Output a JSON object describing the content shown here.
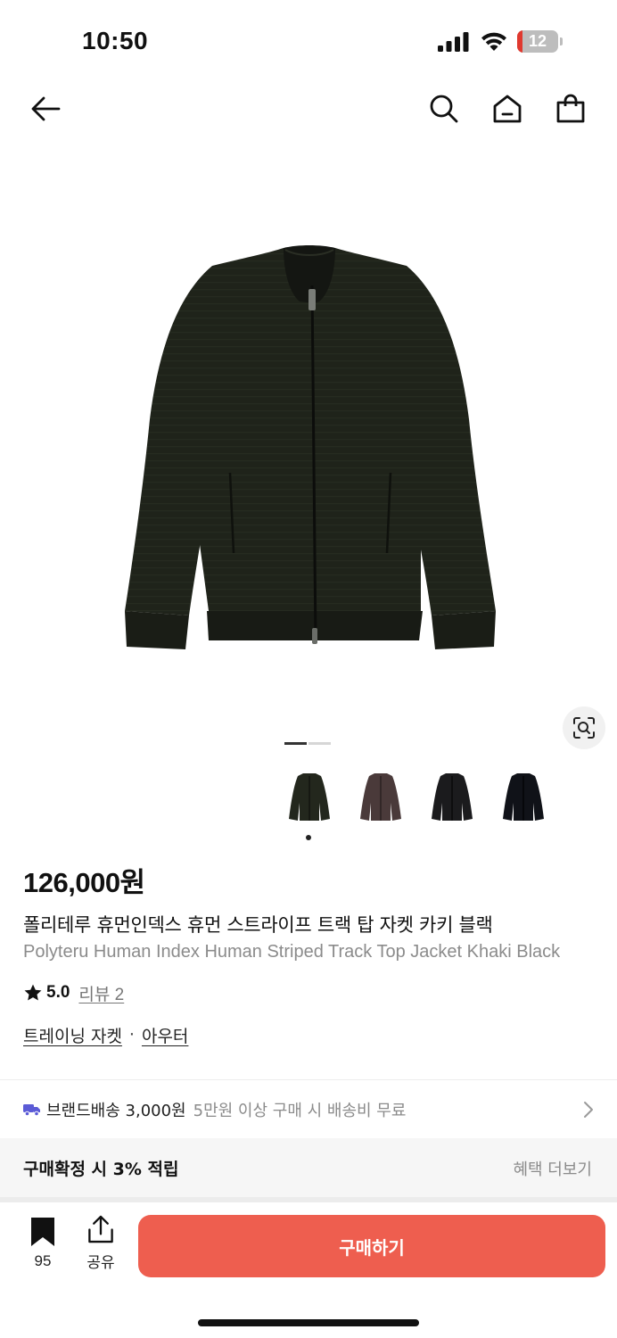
{
  "status_bar": {
    "time": "10:50",
    "battery_level": "12",
    "battery_fraction": 0.12,
    "battery_color": "#e0392f"
  },
  "nav": {
    "icons": [
      "back-arrow-icon",
      "search-icon",
      "home-icon",
      "shopping-bag-icon"
    ]
  },
  "gallery": {
    "current_page": 1,
    "total_pages": 2,
    "active_color": "#333333",
    "inactive_color": "#d6d6d6",
    "thumbnail_colors": [
      "khaki-black",
      "brown",
      "black",
      "navy-black"
    ],
    "selected_thumbnail": 1
  },
  "product": {
    "price": "126,000원",
    "title_ko": "폴리테루 휴먼인덱스 휴먼 스트라이프 트랙 탑 자켓 카키 블랙",
    "title_en": "Polyteru Human Index Human Striped Track Top Jacket Khaki Black",
    "rating": "5.0",
    "review_link": "리뷰 2",
    "categories": [
      "트레이닝 자켓",
      "아우터"
    ],
    "category_separator": "·"
  },
  "shipping": {
    "label": "브랜드배송 3,000원",
    "note": "5만원 이상 구매 시 배송비 무료",
    "icon_color": "#5b5bd6"
  },
  "benefit": {
    "label": "구매확정 시 3% 적립",
    "more": "혜택 더보기"
  },
  "bottom_bar": {
    "wish_count": "95",
    "share_label": "공유",
    "buy_label": "구매하기",
    "buy_color": "#ee5e4f"
  }
}
